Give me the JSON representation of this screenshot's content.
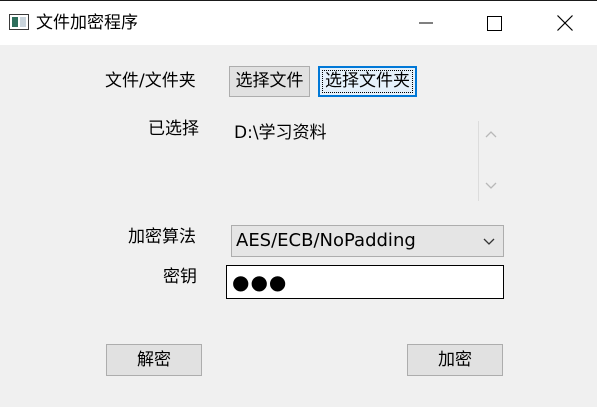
{
  "window": {
    "title": "文件加密程序",
    "icons": {
      "app": "app-window-icon",
      "minimize": "minimize-icon",
      "maximize": "maximize-icon",
      "close": "close-icon"
    }
  },
  "file_row": {
    "label": "文件/文件夹",
    "select_file_button": "选择文件",
    "select_folder_button": "选择文件夹"
  },
  "selected_row": {
    "label": "已选择",
    "path": "D:\\学习资料",
    "icons": {
      "scroll_up": "chevron-up-icon",
      "scroll_down": "chevron-down-icon"
    }
  },
  "algorithm_row": {
    "label": "加密算法",
    "selected_value": "AES/ECB/NoPadding",
    "icon": "chevron-down-icon"
  },
  "key_row": {
    "label": "密钥",
    "masked_value": "●●●"
  },
  "actions": {
    "decrypt_button": "解密",
    "encrypt_button": "加密"
  },
  "colors": {
    "window_bg": "#f0f0f0",
    "titlebar_bg": "#ffffff",
    "button_bg": "#e1e1e1",
    "focus_accent": "#0078d7"
  }
}
